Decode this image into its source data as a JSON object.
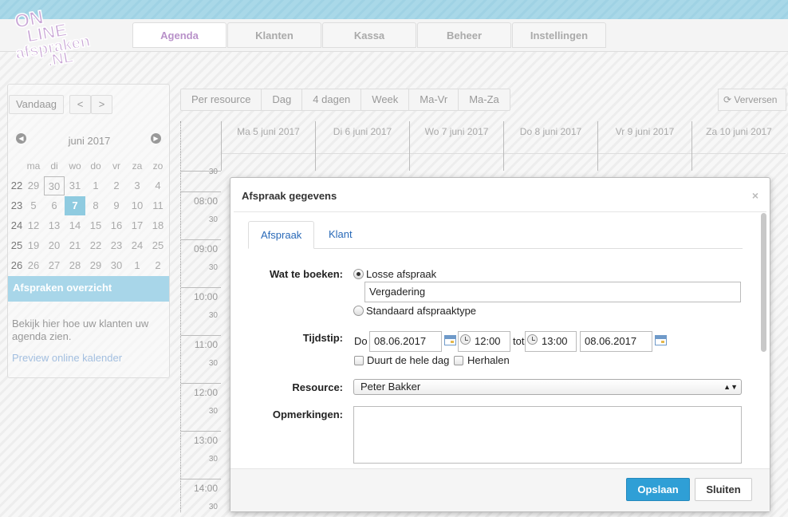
{
  "logo": {
    "text": "ONLINE afspraken .NL"
  },
  "nav": {
    "tabs": [
      {
        "label": "Agenda",
        "active": true
      },
      {
        "label": "Klanten"
      },
      {
        "label": "Kassa"
      },
      {
        "label": "Beheer"
      },
      {
        "label": "Instellingen"
      }
    ]
  },
  "sidebar": {
    "today_label": "Vandaag",
    "prev_label": "<",
    "next_label": ">",
    "month_label": "juni 2017",
    "weekdays": [
      "ma",
      "di",
      "wo",
      "do",
      "vr",
      "za",
      "zo"
    ],
    "weeks": [
      {
        "wk": "22",
        "days": [
          "29",
          "30",
          "31",
          "1",
          "2",
          "3",
          "4"
        ]
      },
      {
        "wk": "23",
        "days": [
          "5",
          "6",
          "7",
          "8",
          "9",
          "10",
          "11"
        ]
      },
      {
        "wk": "24",
        "days": [
          "12",
          "13",
          "14",
          "15",
          "16",
          "17",
          "18"
        ]
      },
      {
        "wk": "25",
        "days": [
          "19",
          "20",
          "21",
          "22",
          "23",
          "24",
          "25"
        ]
      },
      {
        "wk": "26",
        "days": [
          "26",
          "27",
          "28",
          "29",
          "30",
          "1",
          "2"
        ]
      }
    ],
    "selected_day": "7",
    "overview_title": "Afspraken overzicht",
    "overview_text": "Bekijk hier hoe uw klanten uw agenda zien.",
    "preview_link": "Preview online kalender"
  },
  "views": [
    "Per resource",
    "Dag",
    "4 dagen",
    "Week",
    "Ma-Vr",
    "Ma-Za"
  ],
  "refresh_label": "Verversen",
  "calendar": {
    "days": [
      "Ma 5 juni 2017",
      "Di 6 juni 2017",
      "Wo 7 juni 2017",
      "Do 8 juni 2017",
      "Vr 9 juni 2017",
      "Za 10 juni 2017"
    ],
    "hours": [
      "08:00",
      "09:00",
      "10:00",
      "11:00",
      "12:00",
      "13:00",
      "14:00"
    ],
    "half_label": "30"
  },
  "dialog": {
    "title": "Afspraak gegevens",
    "close": "×",
    "tabs": [
      "Afspraak",
      "Klant"
    ],
    "wat_label": "Wat te boeken:",
    "option_losse": "Losse afspraak",
    "losse_value": "Vergadering",
    "option_standaard": "Standaard afspraaktype",
    "tijdstip_label": "Tijdstip:",
    "day_abbr": "Do",
    "start_date": "08.06.2017",
    "start_time": "12:00",
    "tot": "tot",
    "end_time": "13:00",
    "end_date": "08.06.2017",
    "allday_label": "Duurt de hele dag",
    "repeat_label": "Herhalen",
    "resource_label": "Resource:",
    "resource_value": "Peter Bakker",
    "opmerkingen_label": "Opmerkingen:",
    "opmerkingen_value": "",
    "save": "Opslaan",
    "cancel": "Sluiten"
  }
}
